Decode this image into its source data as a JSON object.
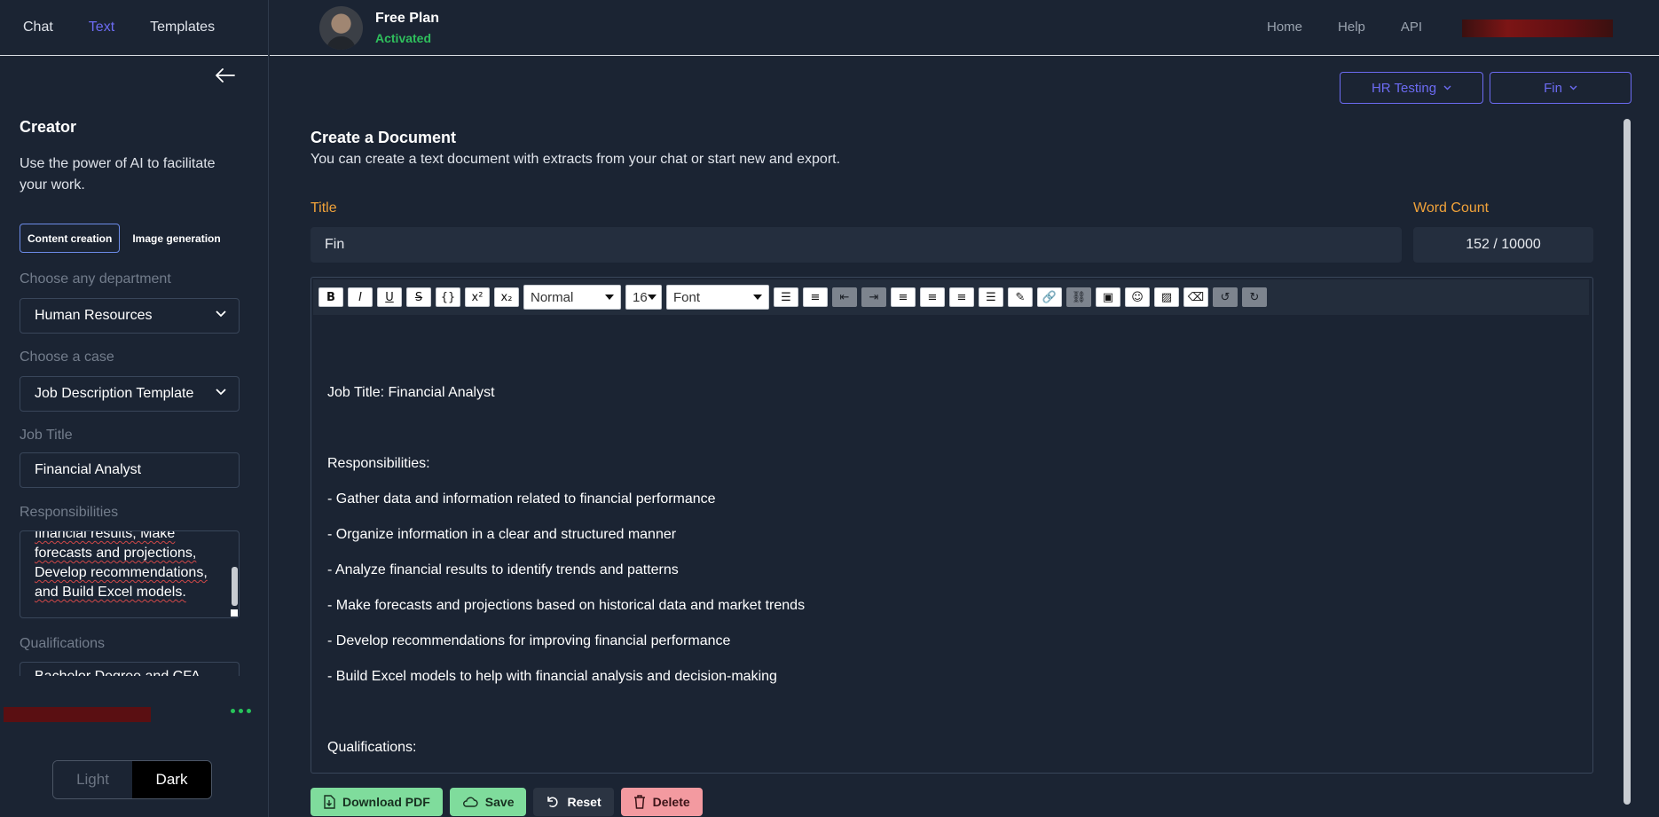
{
  "sidebar": {
    "tabs": [
      {
        "label": "Chat"
      },
      {
        "label": "Text"
      },
      {
        "label": "Templates"
      }
    ],
    "creator_title": "Creator",
    "creator_desc": "Use the power of AI to facilitate your work.",
    "mode_tabs": [
      {
        "label": "Content creation"
      },
      {
        "label": "Image generation"
      }
    ],
    "department": {
      "label": "Choose any department",
      "value": "Human Resources"
    },
    "case": {
      "label": "Choose a case",
      "value": "Job Description Template"
    },
    "job_title": {
      "label": "Job Title",
      "value": "Financial Analyst"
    },
    "responsibilities": {
      "label": "Responsibilities",
      "value": "financial results, Make forecasts and projections, Develop recommendations, and Build Excel models."
    },
    "qualifications": {
      "label": "Qualifications",
      "value": "Bachelor Degree and CFA"
    },
    "theme": {
      "light": "Light",
      "dark": "Dark"
    }
  },
  "header": {
    "plan": "Free Plan",
    "status": "Activated",
    "nav": [
      {
        "label": "Home"
      },
      {
        "label": "Help"
      },
      {
        "label": "API"
      }
    ]
  },
  "main": {
    "dropdowns": [
      {
        "label": "HR Testing"
      },
      {
        "label": "Fin"
      }
    ],
    "heading": "Create a Document",
    "subheading": "You can create a text document with extracts from your chat or start new and export.",
    "title_label": "Title",
    "title_value": "Fin",
    "word_count_label": "Word Count",
    "word_count": "152 / 10000",
    "toolbar": {
      "header_select": "Normal",
      "size_select": "16",
      "font_select": "Font"
    },
    "content": [
      "Job Title: Financial Analyst",
      "",
      "Responsibilities:",
      "- Gather data and information related to financial performance",
      "- Organize information in a clear and structured manner",
      "- Analyze financial results to identify trends and patterns",
      "- Make forecasts and projections based on historical data and market trends",
      "- Develop recommendations for improving financial performance",
      "- Build Excel models to help with financial analysis and decision-making",
      "",
      "Qualifications:"
    ],
    "actions": {
      "download": "Download PDF",
      "save": "Save",
      "reset": "Reset",
      "delete": "Delete"
    }
  },
  "colors": {
    "background": "#1b2433",
    "accent": "#6c6bf2",
    "label_orange": "#f0a23a",
    "status_green": "#2fbf5c"
  }
}
